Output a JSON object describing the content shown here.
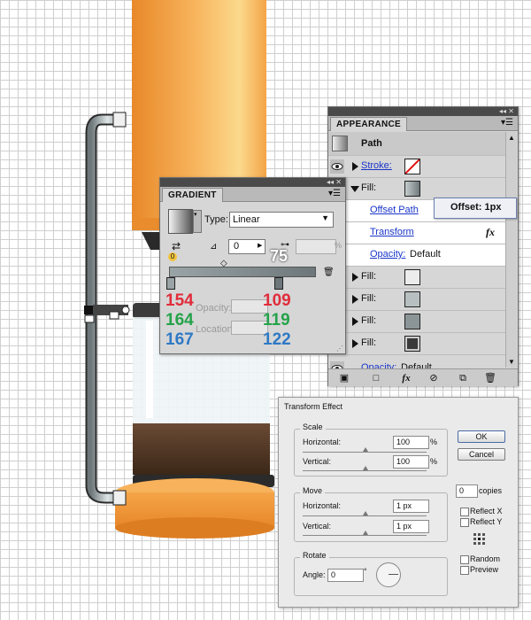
{
  "appearance": {
    "title": "APPEARANCE",
    "header_label": "Path",
    "stroke_label": "Stroke:",
    "fill_label": "Fill:",
    "offset_path": "Offset Path",
    "transform": "Transform",
    "opacity_label": "Opacity:",
    "opacity_value": "Default",
    "fx_label": "fx",
    "tooltip": "Offset: 1px",
    "fill_swatches": [
      "#ececec",
      "#c9c9c9",
      "#a9b2b4",
      "#7d8789",
      "#3a3a3a"
    ]
  },
  "gradient": {
    "title": "GRADIENT",
    "type_label": "Type:",
    "type_value": "Linear",
    "angle_value": "0",
    "aspect_value": "75",
    "percent_sign": "%",
    "zero_badge": "0",
    "opacity_label": "Opacity:",
    "location_label": "Location:",
    "left_stop": {
      "r": "154",
      "g": "164",
      "b": "167"
    },
    "right_stop": {
      "r": "109",
      "g": "119",
      "b": "122"
    }
  },
  "transform_effect": {
    "title": "Transform Effect",
    "scale_group": "Scale",
    "horizontal_label": "Horizontal:",
    "vertical_label": "Vertical:",
    "scale_h": "100",
    "scale_v": "100",
    "percent": "%",
    "move_group": "Move",
    "move_h": "1 px",
    "move_v": "1 px",
    "rotate_group": "Rotate",
    "angle_label": "Angle:",
    "angle_value": "0",
    "degree": "°",
    "ok": "OK",
    "cancel": "Cancel",
    "copies_value": "0",
    "copies_label": "copies",
    "reflect_x": "Reflect X",
    "reflect_y": "Reflect Y",
    "random": "Random",
    "preview": "Preview"
  }
}
